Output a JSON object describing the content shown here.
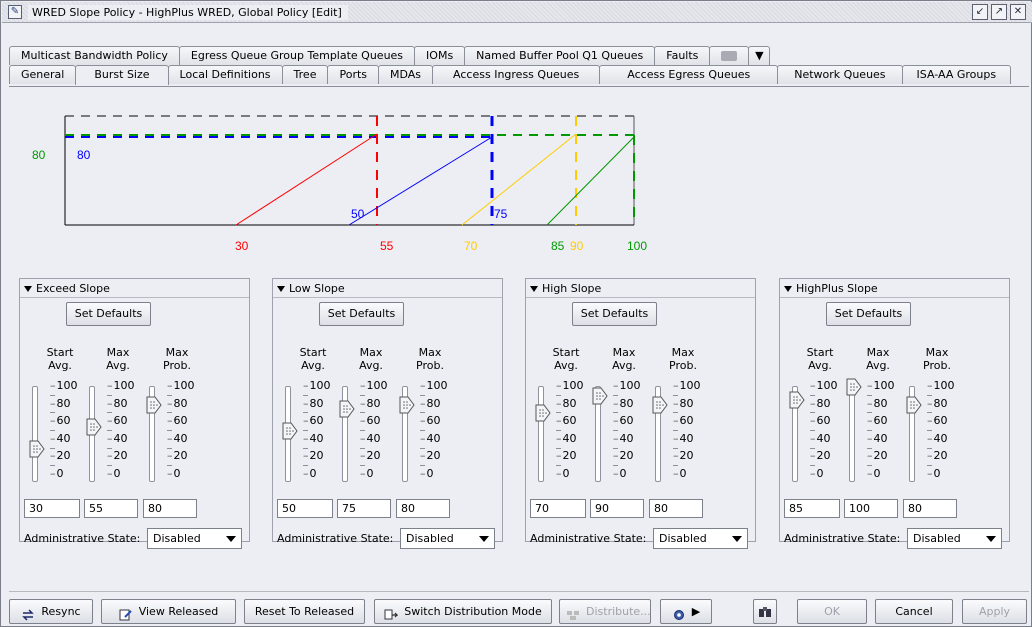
{
  "window": {
    "title": "WRED Slope Policy - HighPlus WRED, Global Policy [Edit]",
    "tb_restore": "↙",
    "tb_max": "↗",
    "tb_close": "✕"
  },
  "tabs_row1": [
    {
      "label": "Multicast Bandwidth Policy"
    },
    {
      "label": "Egress Queue Group Template Queues"
    },
    {
      "label": "IOMs"
    },
    {
      "label": "Named Buffer Pool Q1 Queues"
    },
    {
      "label": "Faults"
    }
  ],
  "tabs_row2": [
    {
      "label": "General"
    },
    {
      "label": "Burst Size"
    },
    {
      "label": "Local Definitions"
    },
    {
      "label": "Tree"
    },
    {
      "label": "Ports"
    },
    {
      "label": "MDAs"
    },
    {
      "label": "Access Ingress Queues"
    },
    {
      "label": "Access Egress Queues"
    },
    {
      "label": "Network Queues"
    },
    {
      "label": "ISA-AA Groups"
    }
  ],
  "active_tab": "Burst Size",
  "graph": {
    "left_labels": {
      "green": "80",
      "blue": "80"
    },
    "inner_labels": {
      "blue_start": "50",
      "yellow_start": "75"
    },
    "x_labels": [
      "30",
      "55",
      "70",
      "85",
      "90",
      "100"
    ],
    "colors": {
      "red": "#ff0000",
      "blue": "#0000ff",
      "yellow": "#ffcc00",
      "green": "#009900",
      "gray": "#555555"
    }
  },
  "column_headers": {
    "start_1": "Start",
    "start_2": "Avg.",
    "maxavg_1": "Max",
    "maxavg_2": "Avg.",
    "maxprob_1": "Max",
    "maxprob_2": "Prob."
  },
  "tick_labels": [
    "100",
    "80",
    "60",
    "40",
    "20",
    "0"
  ],
  "slopes": [
    {
      "title": "Exceed Slope",
      "set_defaults": "Set Defaults",
      "start_avg": "30",
      "max_avg": "55",
      "max_prob": "80",
      "admin_label": "Administrative State:",
      "admin_state": "Disabled"
    },
    {
      "title": "Low Slope",
      "set_defaults": "Set Defaults",
      "start_avg": "50",
      "max_avg": "75",
      "max_prob": "80",
      "admin_label": "Administrative State:",
      "admin_state": "Disabled"
    },
    {
      "title": "High Slope",
      "set_defaults": "Set Defaults",
      "start_avg": "70",
      "max_avg": "90",
      "max_prob": "80",
      "admin_label": "Administrative State:",
      "admin_state": "Disabled"
    },
    {
      "title": "HighPlus Slope",
      "set_defaults": "Set Defaults",
      "start_avg": "85",
      "max_avg": "100",
      "max_prob": "80",
      "admin_label": "Administrative State:",
      "admin_state": "Disabled"
    }
  ],
  "bottom_buttons": {
    "resync": "Resync",
    "view_released": "View Released",
    "reset_to_released": "Reset To Released",
    "switch_distribution_mode": "Switch Distribution Mode",
    "distribute": "Distribute...",
    "ok": "OK",
    "cancel": "Cancel",
    "apply": "Apply"
  }
}
